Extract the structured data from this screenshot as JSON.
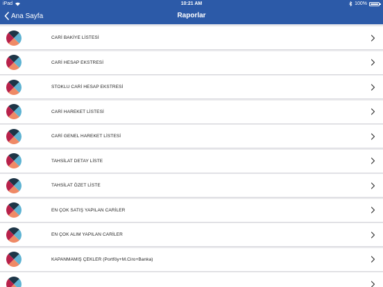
{
  "status_bar": {
    "device": "iPad",
    "time": "10:21 AM",
    "battery": "100%",
    "battery_level": 1.0
  },
  "nav": {
    "back_label": "Ana Sayfa",
    "title": "Raporlar"
  },
  "colors": {
    "nav_bg": "#2c5aa8",
    "icon_navy": "#1d3547",
    "icon_crimson": "#b8214a",
    "icon_orange": "#ef8a66",
    "icon_sky": "#5fb3d2"
  },
  "reports": [
    {
      "label": "CARİ BAKİYE LİSTESİ",
      "icon": "report-pie-icon"
    },
    {
      "label": "CARİ HESAP EKSTRESİ",
      "icon": "report-pie-icon"
    },
    {
      "label": "STOKLU CARİ HESAP EKSTRESİ",
      "icon": "report-pie-icon"
    },
    {
      "label": "CARİ HAREKET LİSTESİ",
      "icon": "report-pie-icon"
    },
    {
      "label": "CARİ GENEL HAREKET LİSTESİ",
      "icon": "report-pie-icon"
    },
    {
      "label": "TAHSİLAT DETAY LİSTE",
      "icon": "report-pie-icon"
    },
    {
      "label": "TAHSİLAT ÖZET LİSTE",
      "icon": "report-pie-icon"
    },
    {
      "label": "EN ÇOK SATIŞ YAPILAN CARİLER",
      "icon": "report-pie-icon"
    },
    {
      "label": "EN ÇOK ALIM YAPILAN CARİLER",
      "icon": "report-pie-icon"
    },
    {
      "label": "KAPANMAMIŞ ÇEKLER (Portföy+M.Ciro+Banka)",
      "icon": "report-pie-icon"
    },
    {
      "label": "",
      "icon": "report-pie-icon"
    }
  ]
}
